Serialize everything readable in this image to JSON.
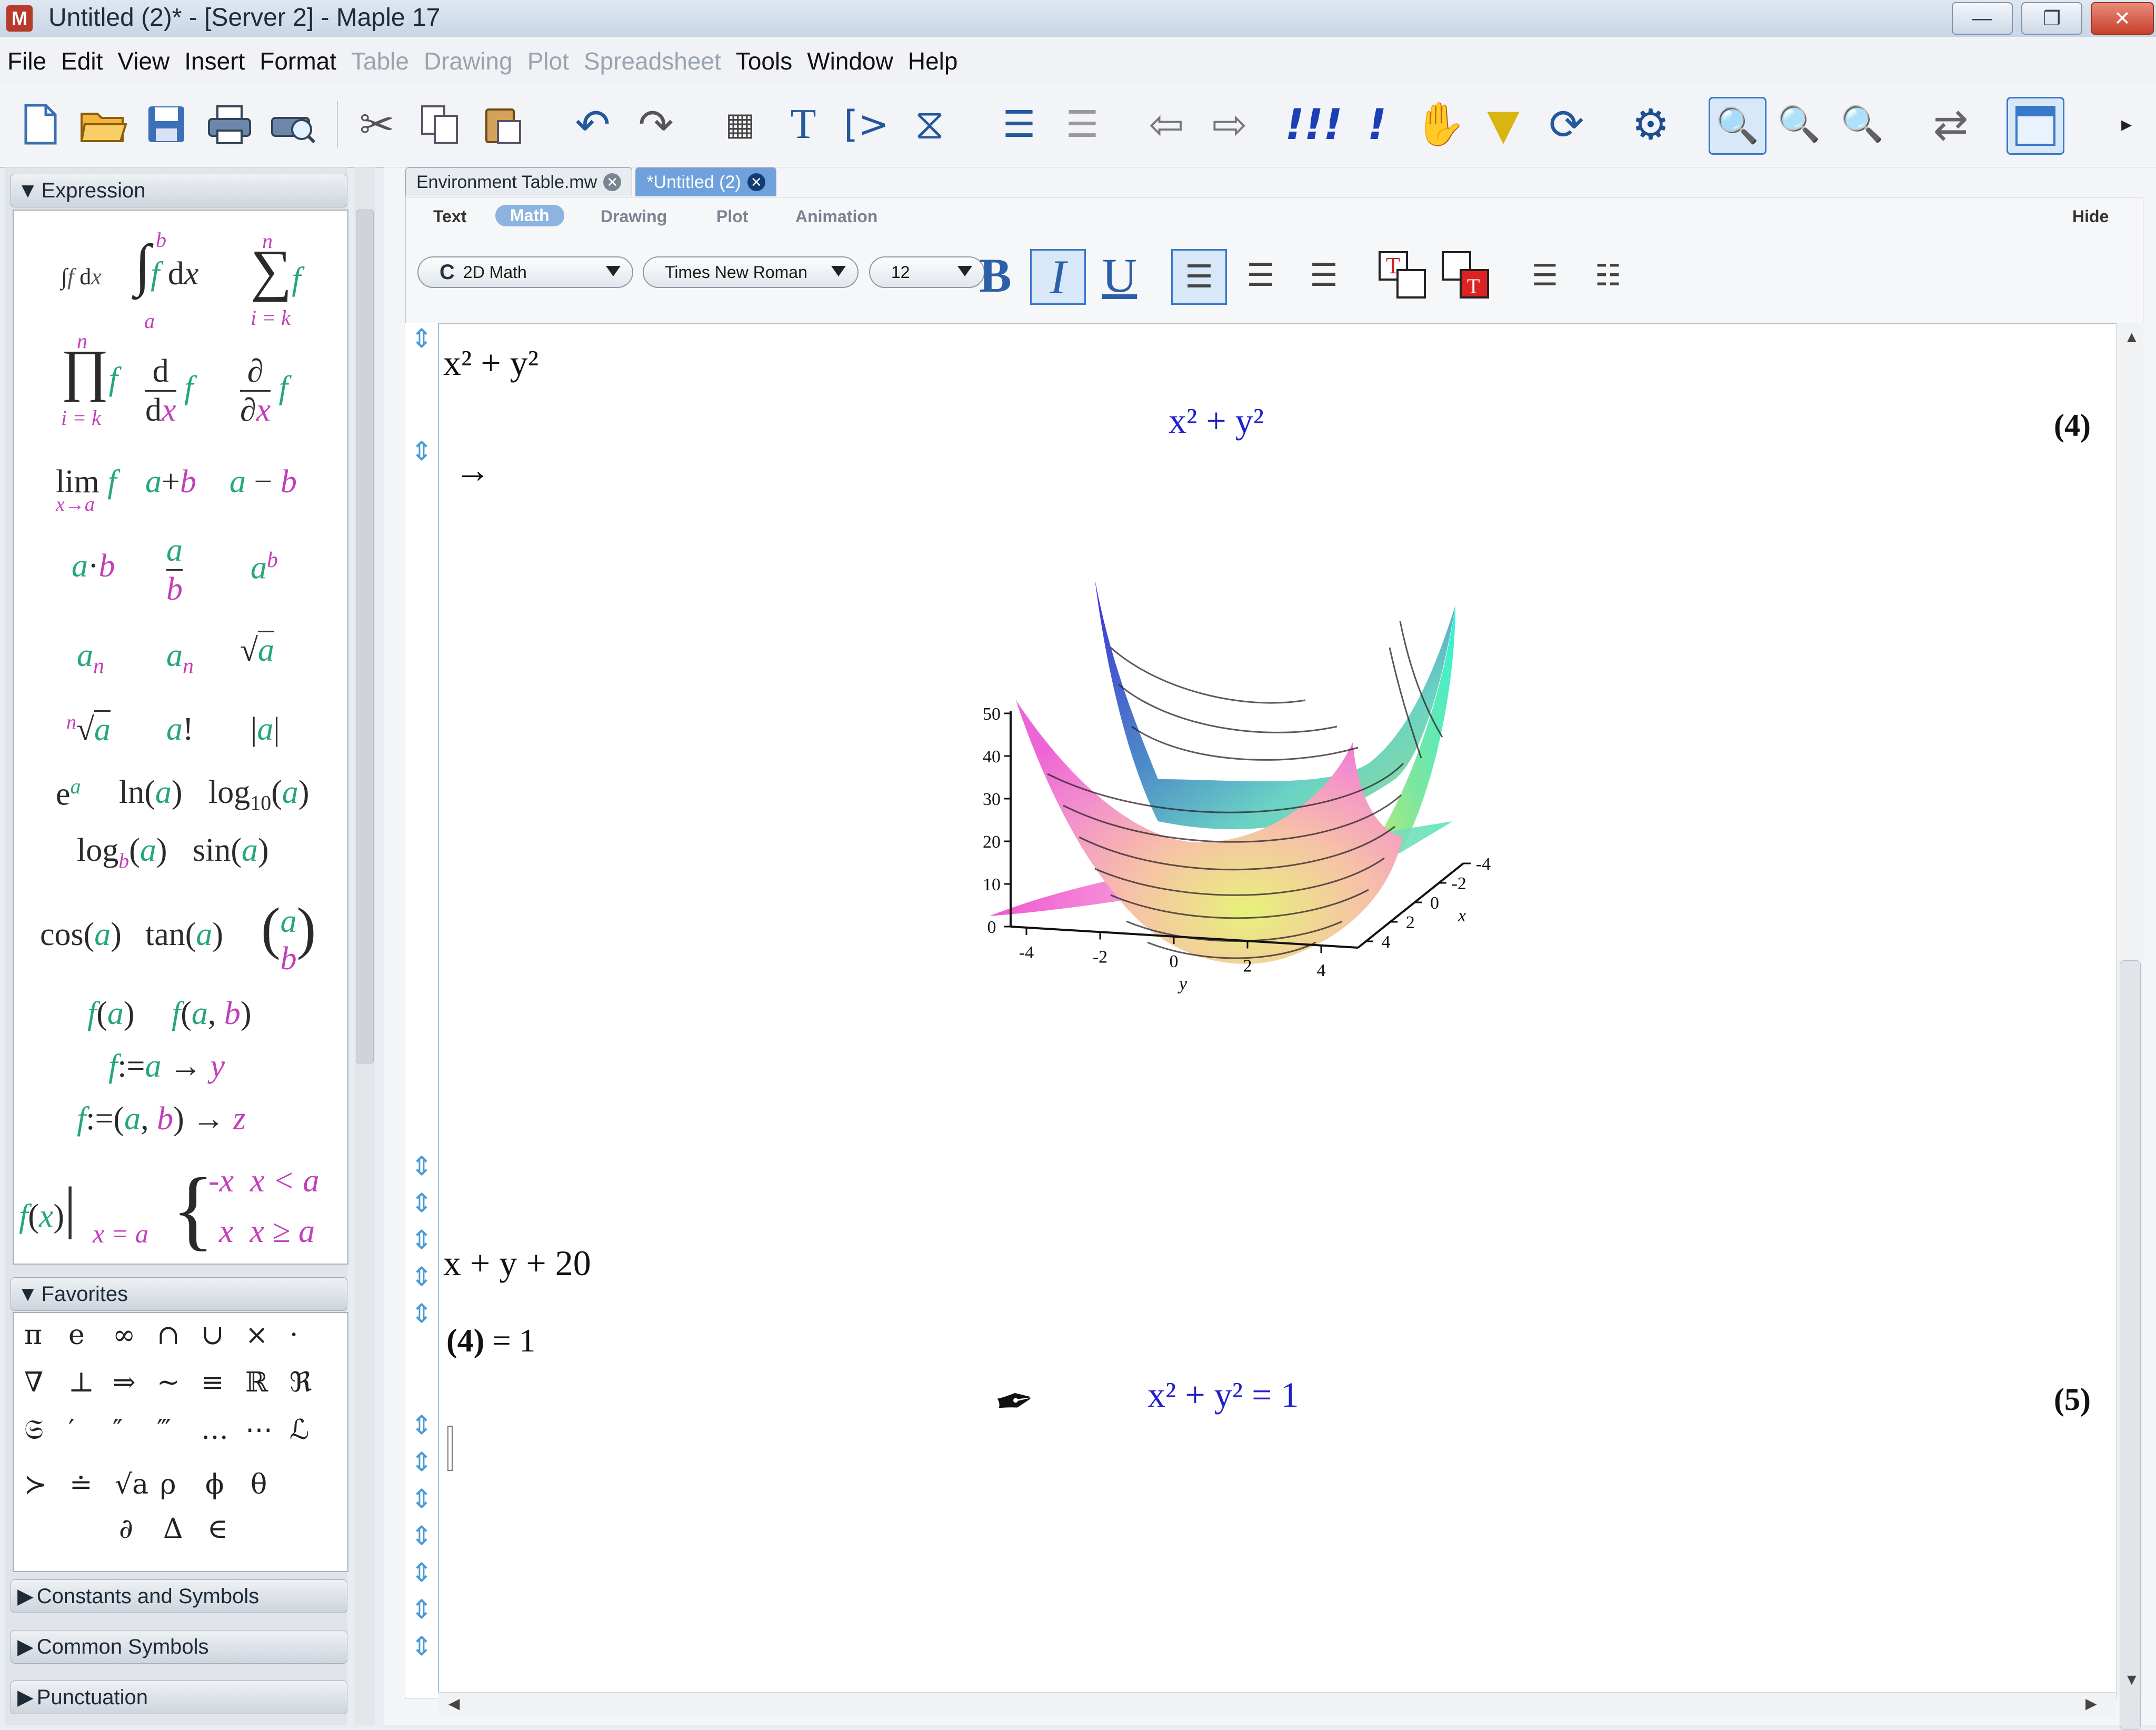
{
  "window": {
    "title": "Untitled (2)* - [Server 2] - Maple 17",
    "app_icon": "maple-leaf-icon",
    "buttons": {
      "minimize": "—",
      "restore": "❐",
      "close": "✕"
    }
  },
  "menubar": {
    "items": [
      {
        "label": "File",
        "enabled": true
      },
      {
        "label": "Edit",
        "enabled": true
      },
      {
        "label": "View",
        "enabled": true
      },
      {
        "label": "Insert",
        "enabled": true
      },
      {
        "label": "Format",
        "enabled": true
      },
      {
        "label": "Table",
        "enabled": false
      },
      {
        "label": "Drawing",
        "enabled": false
      },
      {
        "label": "Plot",
        "enabled": false
      },
      {
        "label": "Spreadsheet",
        "enabled": false
      },
      {
        "label": "Tools",
        "enabled": true
      },
      {
        "label": "Window",
        "enabled": true
      },
      {
        "label": "Help",
        "enabled": true
      }
    ]
  },
  "toolbar": {
    "icons": [
      "new-document-icon",
      "open-folder-icon",
      "save-icon",
      "print-icon",
      "print-preview-icon",
      "cut-icon",
      "copy-icon",
      "paste-icon",
      "undo-icon",
      "redo-icon",
      "insert-table-icon",
      "text-mode-icon",
      "math-prompt-icon",
      "execute-section-icon",
      "indent-icon",
      "outdent-icon",
      "back-icon",
      "forward-icon",
      "execute-all-icon",
      "execute-icon",
      "stop-icon",
      "debug-icon",
      "restart-icon",
      "options-icon",
      "zoom-100-icon",
      "zoom-150-icon",
      "zoom-200-icon",
      "swap-icon",
      "new-window-icon"
    ]
  },
  "palette": {
    "expression_header": "Expression",
    "favorites_header": "Favorites",
    "collapsed_sections": [
      "Constants and Symbols",
      "Common Symbols",
      "Punctuation"
    ],
    "favorites_symbols": [
      [
        "π",
        "e",
        "∞",
        "∩",
        "∪",
        "×",
        "·"
      ],
      [
        "∇",
        "⊥",
        "⇒",
        "~",
        "≡",
        "ℝ",
        "ℜ"
      ],
      [
        "𝔖",
        "′",
        "″",
        "‴",
        "…",
        "⋯",
        "ℒ"
      ],
      [
        "≻",
        "≐",
        "√a",
        "ρ",
        "ϕ",
        "θ"
      ],
      [
        "∂",
        "Δ",
        "∈"
      ]
    ]
  },
  "tabs": [
    {
      "label": "Environment Table.mw",
      "active": false
    },
    {
      "label": "*Untitled (2)",
      "active": true
    }
  ],
  "context_bar": {
    "tabs": [
      {
        "label": "Text",
        "active": false
      },
      {
        "label": "Math",
        "active": true
      },
      {
        "label": "Drawing",
        "active": false
      },
      {
        "label": "Plot",
        "active": false
      },
      {
        "label": "Animation",
        "active": false
      }
    ],
    "hide_label": "Hide",
    "mode": "2D Math",
    "mode_prefix": "C",
    "font": "Times New Roman",
    "size": "12",
    "bold": "B",
    "italic": "I",
    "underline": "U",
    "italic_active": true,
    "align_left_active": true
  },
  "document": {
    "input1": "x² + y²",
    "output1": "x² + y²",
    "label1": "(4)",
    "arrow": "→",
    "input2": "x + y + 20",
    "input3_ref": "(4)",
    "input3_rest": " = 1",
    "output2": "x² + y² = 1",
    "label2": "(5)"
  },
  "chart_data": {
    "type": "surface3d",
    "surfaces": [
      {
        "name": "",
        "expression": "x^2 + y^2"
      },
      {
        "name": "",
        "expression": "x + y + 20"
      }
    ],
    "z_ticks": [
      0,
      10,
      20,
      30,
      40,
      50
    ],
    "y_ticks": [
      -4,
      -2,
      0,
      2,
      4
    ],
    "x_ticks": [
      -4,
      -2,
      0,
      2,
      4
    ],
    "xlabel": "x",
    "ylabel": "y",
    "zlim": [
      0,
      50
    ],
    "colors": {
      "surface_low": "#c7f24a",
      "surface_mid": "#f39ad6",
      "surface_high": "#4d2ee0",
      "plane": "#ee55cc",
      "accent": "#3bf0d0"
    }
  }
}
